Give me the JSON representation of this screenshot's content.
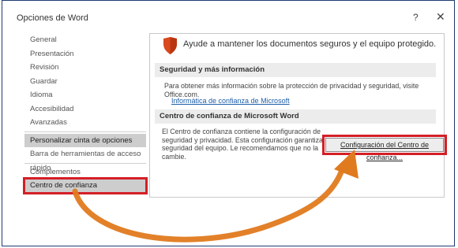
{
  "window": {
    "title": "Opciones de Word",
    "help_label": "?",
    "close_label": "✕"
  },
  "sidebar": {
    "items": [
      {
        "label": "General"
      },
      {
        "label": "Presentación"
      },
      {
        "label": "Revisión"
      },
      {
        "label": "Guardar"
      },
      {
        "label": "Idioma"
      },
      {
        "label": "Accesibilidad"
      },
      {
        "label": "Avanzadas"
      },
      {
        "label": "Personalizar cinta de opciones"
      },
      {
        "label": "Barra de herramientas de acceso rápido"
      },
      {
        "label": "Complementos"
      },
      {
        "label": "Centro de confianza"
      }
    ]
  },
  "main": {
    "headline": "Ayude a mantener los documentos seguros y el equipo protegido.",
    "security_section": {
      "title": "Seguridad y más información",
      "text": "Para obtener más información sobre la protección de privacidad y seguridad, visite Office.com.",
      "link": "Informática de confianza de Microsoft"
    },
    "trust_section": {
      "title": "Centro de confianza de Microsoft Word",
      "text_lines": [
        "El Centro de confianza contiene la configuración de",
        "seguridad y privacidad. Esta configuración garantiza la",
        "seguridad del equipo. Le recomendamos que no la",
        "cambie."
      ],
      "button_label": "Configuración del Centro de confianza..."
    }
  },
  "colors": {
    "highlight_red": "#d41f26",
    "arrow_orange": "#e07a1e",
    "selected_gray": "#cdcdcd",
    "frame_blue": "#1f3b73",
    "link_blue": "#1e5faa",
    "shield_red": "#d9481e"
  },
  "icons": {
    "shield": "shield-icon",
    "help": "help-icon",
    "close": "close-icon"
  }
}
